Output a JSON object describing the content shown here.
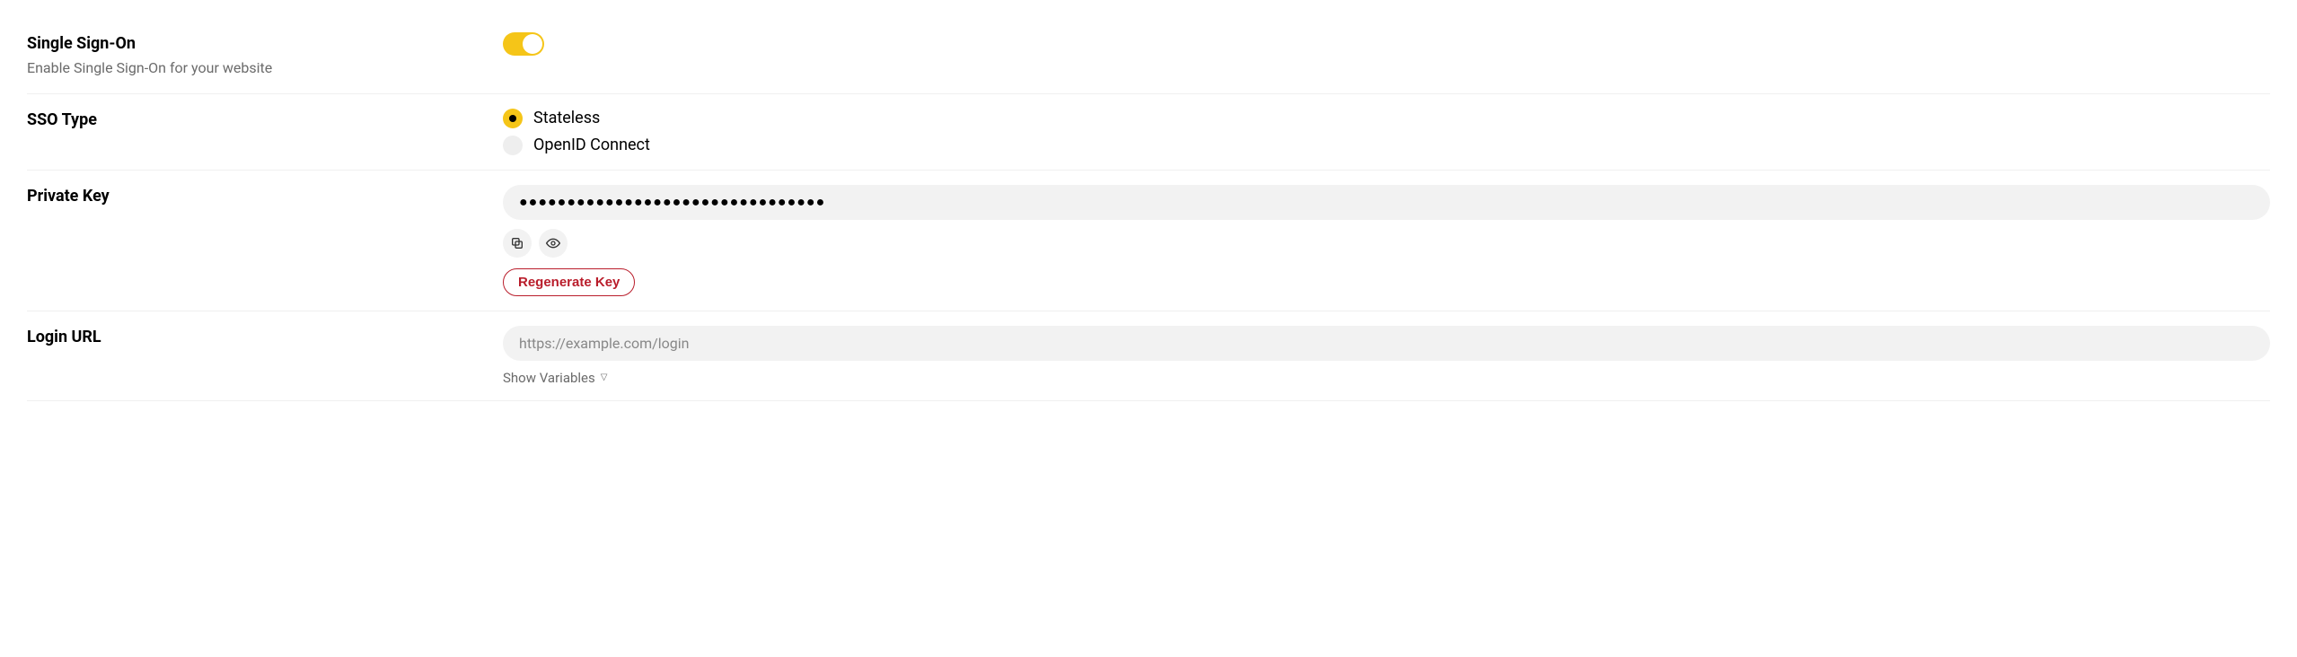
{
  "sso": {
    "title": "Single Sign-On",
    "subtitle": "Enable Single Sign-On for your website",
    "enabled": true
  },
  "sso_type": {
    "title": "SSO Type",
    "options": [
      {
        "label": "Stateless",
        "selected": true
      },
      {
        "label": "OpenID Connect",
        "selected": false
      }
    ]
  },
  "private_key": {
    "title": "Private Key",
    "masked_value": "●●●●●●●●●●●●●●●●●●●●●●●●●●●●●●●●",
    "regenerate_label": "Regenerate Key"
  },
  "login_url": {
    "title": "Login URL",
    "placeholder": "https://example.com/login",
    "value": "",
    "show_variables_label": "Show Variables"
  }
}
